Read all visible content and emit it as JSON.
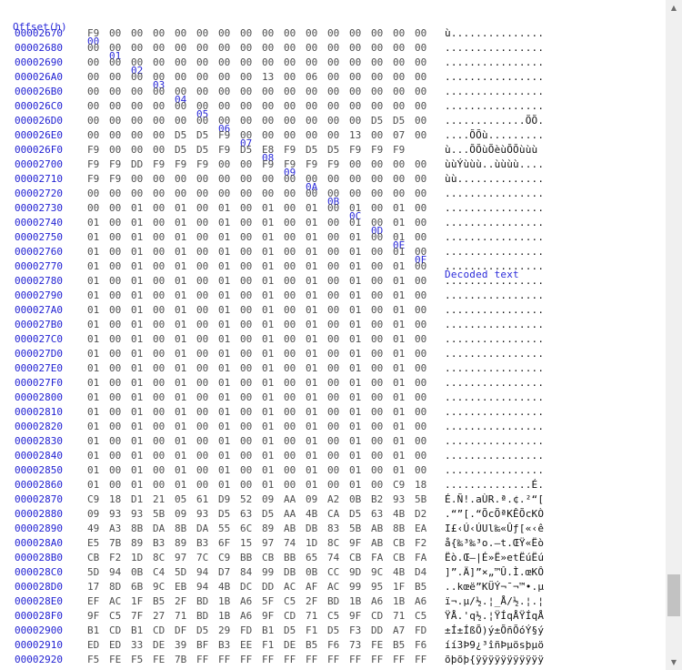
{
  "header": {
    "offset_label": "Offset(h)",
    "columns": [
      "00",
      "01",
      "02",
      "03",
      "04",
      "05",
      "06",
      "07",
      "08",
      "09",
      "0A",
      "0B",
      "0C",
      "0D",
      "0E",
      "0F"
    ],
    "decoded_label": "Decoded text"
  },
  "rows": [
    {
      "offset": "00002670",
      "hex": "F9 00 00 00 00 00 00 00 00 00 00 00 00 00 00 00",
      "text": "ù..............."
    },
    {
      "offset": "00002680",
      "hex": "00 00 00 00 00 00 00 00 00 00 00 00 00 00 00 00",
      "text": "................"
    },
    {
      "offset": "00002690",
      "hex": "00 00 00 00 00 00 00 00 00 00 00 00 00 00 00 00",
      "text": "................"
    },
    {
      "offset": "000026A0",
      "hex": "00 00 00 00 00 00 00 00 13 00 06 00 00 00 00 00",
      "text": "................"
    },
    {
      "offset": "000026B0",
      "hex": "00 00 00 00 00 00 00 00 00 00 00 00 00 00 00 00",
      "text": "................"
    },
    {
      "offset": "000026C0",
      "hex": "00 00 00 00 00 00 00 00 00 00 00 00 00 00 00 00",
      "text": "................"
    },
    {
      "offset": "000026D0",
      "hex": "00 00 00 00 00 00 00 00 00 00 00 00 00 D5 D5 00",
      "text": ".............ÕÕ."
    },
    {
      "offset": "000026E0",
      "hex": "00 00 00 00 D5 D5 F9 00 00 00 00 00 13 00 07 00",
      "text": "....ÕÕù........."
    },
    {
      "offset": "000026F0",
      "hex": "F9 00 00 00 D5 D5 F9 D5 E8 F9 D5 D5 F9 F9 F9",
      "text": "ù...ÕÕùÕèùÕÕùùù"
    },
    {
      "offset": "00002700",
      "hex": "F9 F9 DD F9 F9 F9 00 00 F9 F9 F9 F9 00 00 00 00",
      "text": "ùùÝùùù..ùùùù...."
    },
    {
      "offset": "00002710",
      "hex": "F9 F9 00 00 00 00 00 00 00 00 00 00 00 00 00 00",
      "text": "ùù.............."
    },
    {
      "offset": "00002720",
      "hex": "00 00 00 00 00 00 00 00 00 00 00 00 00 00 00 00",
      "text": "................"
    },
    {
      "offset": "00002730",
      "hex": "00 00 01 00 01 00 01 00 01 00 01 00 01 00 01 00",
      "text": "................"
    },
    {
      "offset": "00002740",
      "hex": "01 00 01 00 01 00 01 00 01 00 01 00 01 00 01 00",
      "text": "................"
    },
    {
      "offset": "00002750",
      "hex": "01 00 01 00 01 00 01 00 01 00 01 00 01 00 01 00",
      "text": "................"
    },
    {
      "offset": "00002760",
      "hex": "01 00 01 00 01 00 01 00 01 00 01 00 01 00 01 00",
      "text": "................"
    },
    {
      "offset": "00002770",
      "hex": "01 00 01 00 01 00 01 00 01 00 01 00 01 00 01 00",
      "text": "................"
    },
    {
      "offset": "00002780",
      "hex": "01 00 01 00 01 00 01 00 01 00 01 00 01 00 01 00",
      "text": "................"
    },
    {
      "offset": "00002790",
      "hex": "01 00 01 00 01 00 01 00 01 00 01 00 01 00 01 00",
      "text": "................"
    },
    {
      "offset": "000027A0",
      "hex": "01 00 01 00 01 00 01 00 01 00 01 00 01 00 01 00",
      "text": "................"
    },
    {
      "offset": "000027B0",
      "hex": "01 00 01 00 01 00 01 00 01 00 01 00 01 00 01 00",
      "text": "................"
    },
    {
      "offset": "000027C0",
      "hex": "01 00 01 00 01 00 01 00 01 00 01 00 01 00 01 00",
      "text": "................"
    },
    {
      "offset": "000027D0",
      "hex": "01 00 01 00 01 00 01 00 01 00 01 00 01 00 01 00",
      "text": "................"
    },
    {
      "offset": "000027E0",
      "hex": "01 00 01 00 01 00 01 00 01 00 01 00 01 00 01 00",
      "text": "................"
    },
    {
      "offset": "000027F0",
      "hex": "01 00 01 00 01 00 01 00 01 00 01 00 01 00 01 00",
      "text": "................"
    },
    {
      "offset": "00002800",
      "hex": "01 00 01 00 01 00 01 00 01 00 01 00 01 00 01 00",
      "text": "................"
    },
    {
      "offset": "00002810",
      "hex": "01 00 01 00 01 00 01 00 01 00 01 00 01 00 01 00",
      "text": "................"
    },
    {
      "offset": "00002820",
      "hex": "01 00 01 00 01 00 01 00 01 00 01 00 01 00 01 00",
      "text": "................"
    },
    {
      "offset": "00002830",
      "hex": "01 00 01 00 01 00 01 00 01 00 01 00 01 00 01 00",
      "text": "................"
    },
    {
      "offset": "00002840",
      "hex": "01 00 01 00 01 00 01 00 01 00 01 00 01 00 01 00",
      "text": "................"
    },
    {
      "offset": "00002850",
      "hex": "01 00 01 00 01 00 01 00 01 00 01 00 01 00 01 00",
      "text": "................"
    },
    {
      "offset": "00002860",
      "hex": "01 00 01 00 01 00 01 00 01 00 01 00 01 00 C9 18",
      "text": "..............É."
    },
    {
      "offset": "00002870",
      "hex": "C9 18 D1 21 05 61 D9 52 09 AA 09 A2 0B B2 93 5B",
      "text": "É.Ñ!.aÙR.ª.¢.²“["
    },
    {
      "offset": "00002880",
      "hex": "09 93 93 5B 09 93 D5 63 D5 AA 4B CA D5 63 4B D2",
      "text": ".“”[.“ÕcÕªKÊÕcKÒ"
    },
    {
      "offset": "00002890",
      "hex": "49 A3 8B DA 8B DA 55 6C 89 AB DB 83 5B AB 8B EA",
      "text": "I£‹Ú‹ÚUl‰«Ûƒ[«‹ê"
    },
    {
      "offset": "000028A0",
      "hex": "E5 7B 89 B3 89 B3 6F 15 97 74 1D 8C 9F AB CB F2",
      "text": "å{‰³‰³o.—t.ŒŸ«Ëò"
    },
    {
      "offset": "000028B0",
      "hex": "CB F2 1D 8C 97 7C C9 BB CB BB 65 74 CB FA CB FA",
      "text": "Ëò.Œ—|É»Ë»etËúËú"
    },
    {
      "offset": "000028C0",
      "hex": "5D 94 0B C4 5D 94 D7 84 99 DB 0B CC 9D 9C 4B D4",
      "text": "]”.Ä]”×„™Û.Ì.œKÔ"
    },
    {
      "offset": "000028D0",
      "hex": "17 8D 6B 9C EB 94 4B DC DD AC AF AC 99 95 1F B5",
      "text": "..kœë”KÜÝ¬¯¬™•.µ"
    },
    {
      "offset": "000028E0",
      "hex": "EF AC 1F B5 2F BD 1B A6 5F C5 2F BD 1B A6 1B A6",
      "text": "ï¬.µ/½.¦_Å/½.¦.¦"
    },
    {
      "offset": "000028F0",
      "hex": "9F C5 7F 27 71 BD 1B A6 9F CD 71 C5 9F CD 71 C5",
      "text": "ŸÅ.'q½.¦ŸÍqÅŸÍqÅ"
    },
    {
      "offset": "00002900",
      "hex": "B1 CD B1 CD DF D5 29 FD B1 D5 F1 D5 F3 DD A7 FD",
      "text": "±Í±ÍßÕ)ý±ÕñÕóÝ§ý"
    },
    {
      "offset": "00002910",
      "hex": "ED ED 33 DE 39 BF B3 EE F1 DE B5 F6 73 FE B5 F6",
      "text": "íí3Þ9¿³îñÞµösþµö"
    },
    {
      "offset": "00002920",
      "hex": "F5 FE F5 FE 7B FF FF FF FF FF FF FF FF FF FF FF",
      "text": "õþõþ{ÿÿÿÿÿÿÿÿÿÿÿ"
    }
  ]
}
